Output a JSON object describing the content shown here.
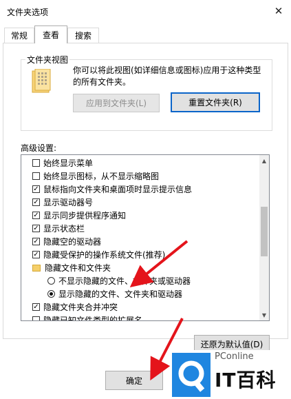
{
  "window": {
    "title": "文件夹选项",
    "close_icon": "close-icon"
  },
  "tabs": [
    {
      "label": "常规"
    },
    {
      "label": "查看",
      "active": true
    },
    {
      "label": "搜索"
    }
  ],
  "folder_views": {
    "legend": "文件夹视图",
    "description": "你可以将此视图(如详细信息或图标)应用于这种类型的所有文件夹。",
    "apply_button": "应用到文件夹(L)",
    "reset_button": "重置文件夹(R)"
  },
  "advanced": {
    "label": "高级设置:",
    "items": [
      {
        "type": "checkbox",
        "label": "始终显示菜单",
        "checked": false
      },
      {
        "type": "checkbox",
        "label": "始终显示图标，从不显示缩略图",
        "checked": false
      },
      {
        "type": "checkbox",
        "label": "鼠标指向文件夹和桌面项时显示提示信息",
        "checked": true
      },
      {
        "type": "checkbox",
        "label": "显示驱动器号",
        "checked": true
      },
      {
        "type": "checkbox",
        "label": "显示同步提供程序通知",
        "checked": true
      },
      {
        "type": "checkbox",
        "label": "显示状态栏",
        "checked": true
      },
      {
        "type": "checkbox",
        "label": "隐藏空的驱动器",
        "checked": true
      },
      {
        "type": "checkbox",
        "label": "隐藏受保护的操作系统文件(推荐)",
        "checked": true
      },
      {
        "type": "folder",
        "label": "隐藏文件和文件夹"
      },
      {
        "type": "radio",
        "label": "不显示隐藏的文件、文件夹或驱动器",
        "checked": false
      },
      {
        "type": "radio",
        "label": "显示隐藏的文件、文件夹和驱动器",
        "checked": true
      },
      {
        "type": "checkbox",
        "label": "隐藏文件夹合并冲突",
        "checked": true
      },
      {
        "type": "checkbox",
        "label": "隐藏已知文件类型的扩展名",
        "checked": false
      }
    ]
  },
  "buttons": {
    "restore_defaults": "还原为默认值(D)",
    "ok": "确定"
  },
  "watermark": {
    "brand": "PConline",
    "big_text": "IT百科"
  },
  "colors": {
    "accent": "#0a64c9",
    "annotation_arrow": "#e4141b"
  }
}
